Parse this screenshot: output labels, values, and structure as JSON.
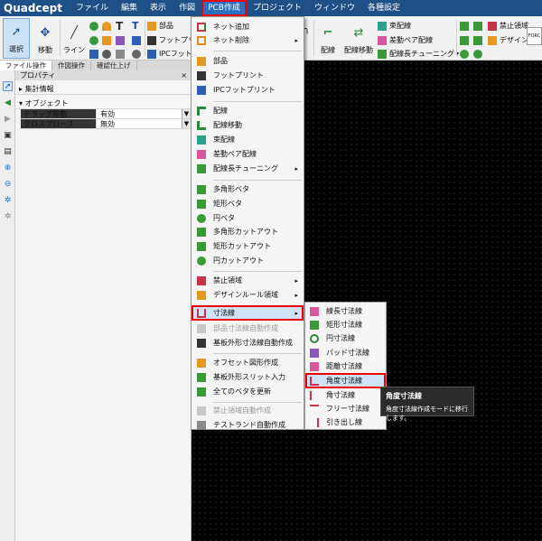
{
  "app": {
    "logo": "Quadcept"
  },
  "menubar": [
    "ファイル",
    "編集",
    "表示",
    "作図",
    "PCB作成",
    "プロジェクト",
    "ウィンドウ",
    "各種設定"
  ],
  "ribbon": {
    "select": "選択",
    "move": "移動",
    "line": "ライン",
    "part": "部品",
    "footprint": "フットプリ",
    "ipc": "IPCフット",
    "wire": "配線",
    "wire_move": "配線移動",
    "bundle": "束配線",
    "diff": "差動ペア配線",
    "length_tune": "配線長チューニング",
    "keepout": "禁止領域",
    "design": "デザイン",
    "forc": "FORC"
  },
  "tabs": [
    "ファイル操作",
    "作図操作",
    "確認仕上げ"
  ],
  "property": {
    "title": "プロパティ",
    "close": "×",
    "section_total": "集計情報",
    "section_object": "オブジェクト",
    "rows": [
      {
        "key": "ドラッグ移動",
        "value": "有効"
      },
      {
        "key": "クロスプローブ",
        "value": "無効"
      }
    ]
  },
  "menu": [
    {
      "label": "ネット追加",
      "icon": "net-add-icon"
    },
    {
      "label": "ネット削除",
      "icon": "net-delete-icon",
      "arrow": "▸"
    },
    {
      "label": "部品",
      "icon": "part-icon"
    },
    {
      "label": "フットプリント",
      "icon": "footprint-icon"
    },
    {
      "label": "IPCフットプリント",
      "icon": "ipc-footprint-icon"
    },
    {
      "label": "配線",
      "icon": "wire-icon"
    },
    {
      "label": "配線移動",
      "icon": "wire-move-icon"
    },
    {
      "label": "束配線",
      "icon": "bundle-wire-icon"
    },
    {
      "label": "差動ペア配線",
      "icon": "diff-pair-icon"
    },
    {
      "label": "配線長チューニング",
      "icon": "length-tuning-icon",
      "arrow": "▸"
    },
    {
      "label": "多角形ベタ",
      "icon": "polygon-fill-icon"
    },
    {
      "label": "矩形ベタ",
      "icon": "rect-fill-icon"
    },
    {
      "label": "円ベタ",
      "icon": "circle-fill-icon"
    },
    {
      "label": "多角形カットアウト",
      "icon": "polygon-cutout-icon"
    },
    {
      "label": "矩形カットアウト",
      "icon": "rect-cutout-icon"
    },
    {
      "label": "円カットアウト",
      "icon": "circle-cutout-icon"
    },
    {
      "label": "禁止領域",
      "icon": "keepout-icon",
      "arrow": "▸"
    },
    {
      "label": "デザインルール領域",
      "icon": "design-rule-icon",
      "arrow": "▸"
    },
    {
      "label": "寸法線",
      "icon": "dimension-icon",
      "arrow": "▸"
    },
    {
      "label": "部品寸法線自動作成",
      "icon": "auto-part-dimension-icon"
    },
    {
      "label": "基板外形寸法線自動作成",
      "icon": "auto-board-dimension-icon"
    },
    {
      "label": "オフセット図形作成",
      "icon": "offset-shape-icon"
    },
    {
      "label": "基板外形スリット入力",
      "icon": "board-slit-icon"
    },
    {
      "label": "全てのベタを更新",
      "icon": "update-fills-icon"
    },
    {
      "label": "禁止領域自動作成",
      "icon": "auto-keepout-icon"
    },
    {
      "label": "テストランド自動作成",
      "icon": "test-land-icon"
    }
  ],
  "submenu": [
    {
      "label": "線長寸法線",
      "icon": "linear-dimension-icon"
    },
    {
      "label": "矩形寸法線",
      "icon": "rect-dimension-icon"
    },
    {
      "label": "円寸法線",
      "icon": "circle-dimension-icon"
    },
    {
      "label": "パッド寸法線",
      "icon": "pad-dimension-icon"
    },
    {
      "label": "距離寸法線",
      "icon": "distance-dimension-icon"
    },
    {
      "label": "角度寸法線",
      "icon": "angle-dimension-icon"
    },
    {
      "label": "角寸法線",
      "icon": "corner-dimension-icon"
    },
    {
      "label": "フリー寸法線",
      "icon": "free-dimension-icon"
    },
    {
      "label": "引き出し線",
      "icon": "leader-line-icon"
    }
  ],
  "tooltip": {
    "title": "角度寸法線",
    "desc": "角度寸法線作成モードに移行します。"
  }
}
